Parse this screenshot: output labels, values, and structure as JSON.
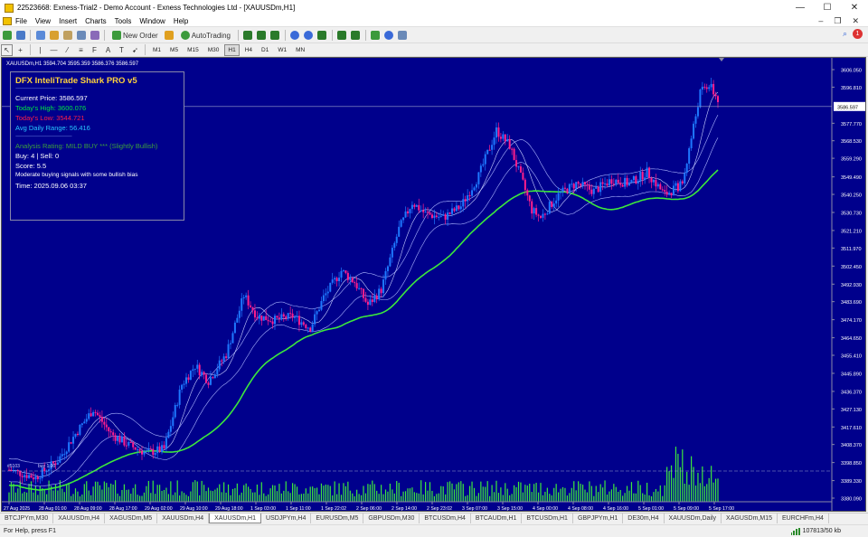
{
  "window": {
    "title": "22523668: Exness-Trial2 - Demo Account - Exness Technologies Ltd - [XAUUSDm,H1]",
    "controls": [
      "—",
      "☐",
      "✕"
    ]
  },
  "menu": {
    "items": [
      "File",
      "View",
      "Insert",
      "Charts",
      "Tools",
      "Window",
      "Help"
    ],
    "alert_count": "1"
  },
  "toolbar": {
    "new_order": "New Order",
    "autotrading": "AutoTrading",
    "timeframes": [
      "M1",
      "M5",
      "M15",
      "M30",
      "H1",
      "H4",
      "D1",
      "W1",
      "MN"
    ],
    "active_timeframe": "H1"
  },
  "chart": {
    "header": "XAUUSDm,H1  3594.704 3595.359 3586.376 3586.597",
    "current_price_label": "3586.597",
    "y_ticks": [
      "3606.050",
      "3596.810",
      "3586.597",
      "3577.770",
      "3568.530",
      "3559.290",
      "3549.490",
      "3540.250",
      "3530.730",
      "3521.210",
      "3511.970",
      "3502.450",
      "3492.930",
      "3483.690",
      "3474.170",
      "3464.650",
      "3455.410",
      "3445.890",
      "3436.370",
      "3427.130",
      "3417.610",
      "3408.370",
      "3398.850",
      "3389.330",
      "3380.090"
    ],
    "x_ticks": [
      "27 Aug 2025",
      "28 Aug 01:00",
      "28 Aug 09:00",
      "28 Aug 17:00",
      "29 Aug 02:00",
      "29 Aug 10:00",
      "29 Aug 18:00",
      "1 Sep 03:00",
      "1 Sep 11:00",
      "1 Sep 22:02",
      "2 Sep 06:00",
      "2 Sep 14:00",
      "2 Sep 23:02",
      "3 Sep 07:00",
      "3 Sep 15:00",
      "4 Sep 00:00",
      "4 Sep 08:00",
      "4 Sep 16:00",
      "5 Sep 01:00",
      "5 Sep 09:00",
      "5 Sep 17:00"
    ],
    "volume_labels": [
      "#5103",
      "buy 1.00"
    ],
    "colors": {
      "background": "#00008c",
      "bull": "#1e78ff",
      "bear": "#ff1f8c",
      "ma_slow": "#3ce83c",
      "bands": "#aab4ff"
    }
  },
  "panel": {
    "title": "DFX InteliTrade Shark PRO v5",
    "separator": "--------------------------------------------------------------",
    "current_price": "Current Price: 3586.597",
    "todays_high": "Today's High: 3600.076",
    "todays_low": "Today's Low: 3544.721",
    "avg_daily_range": "Avg Daily Range: 56.416",
    "analysis_rating": "Analysis Rating: MILD BUY *** (Slightly Bullish)",
    "buy_sell": "Buy: 4 | Sell: 0",
    "score": "Score: 5.5",
    "description": "Moderate buying signals with some bullish bias",
    "time": "Time: 2025.09.06 03:37"
  },
  "tabs": [
    "BTCJPYm,M30",
    "XAUUSDm,H4",
    "XAGUSDm,M5",
    "XAUUSDm,H4",
    "XAUUSDm,H1",
    "USDJPYm,H4",
    "EURUSDm,M5",
    "GBPUSDm,M30",
    "BTCUSDm,H4",
    "BTCAUDm,H1",
    "BTCUSDm,H1",
    "GBPJPYm,H1",
    "DE30m,H4",
    "XAUUSDm,Daily",
    "XAGUSDm,M15",
    "EURCHFm,H4"
  ],
  "active_tab_index": 4,
  "status": {
    "help": "For Help, press F1",
    "traffic": "107813/50 kb"
  }
}
